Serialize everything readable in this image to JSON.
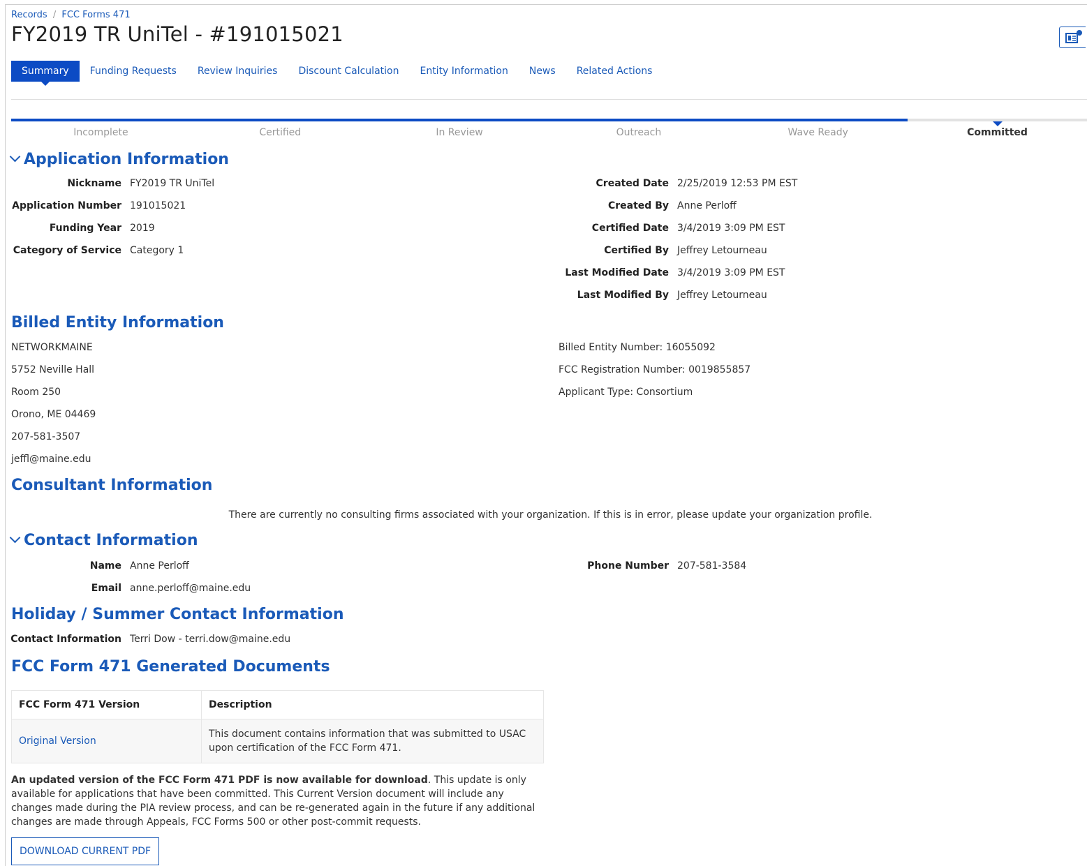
{
  "breadcrumb": {
    "root": "Records",
    "separator": "/",
    "current": "FCC Forms 471"
  },
  "page_title": "FY2019 TR UniTel - #191015021",
  "help_icon": "report-settings-icon",
  "tabs": [
    {
      "label": "Summary",
      "active": true
    },
    {
      "label": "Funding Requests"
    },
    {
      "label": "Review Inquiries"
    },
    {
      "label": "Discount Calculation"
    },
    {
      "label": "Entity Information"
    },
    {
      "label": "News"
    },
    {
      "label": "Related Actions"
    }
  ],
  "status_steps": {
    "items": [
      "Incomplete",
      "Certified",
      "In Review",
      "Outreach",
      "Wave Ready",
      "Committed"
    ],
    "current": "Committed"
  },
  "application_information": {
    "title": "Application Information",
    "left": [
      {
        "label": "Nickname",
        "value": "FY2019 TR UniTel"
      },
      {
        "label": "Application Number",
        "value": "191015021"
      },
      {
        "label": "Funding Year",
        "value": "2019"
      },
      {
        "label": "Category of Service",
        "value": "Category 1"
      }
    ],
    "right": [
      {
        "label": "Created Date",
        "value": "2/25/2019 12:53 PM EST"
      },
      {
        "label": "Created By",
        "value": "Anne Perloff"
      },
      {
        "label": "Certified Date",
        "value": "3/4/2019 3:09 PM EST"
      },
      {
        "label": "Certified By",
        "value": "Jeffrey Letourneau"
      },
      {
        "label": "Last Modified Date",
        "value": "3/4/2019 3:09 PM EST"
      },
      {
        "label": "Last Modified By",
        "value": "Jeffrey Letourneau"
      }
    ]
  },
  "billed_entity": {
    "title": "Billed Entity Information",
    "address_lines": [
      "NETWORKMAINE",
      "5752 Neville Hall",
      "Room 250",
      "Orono, ME 04469",
      "207-581-3507",
      "jeffl@maine.edu"
    ],
    "details": [
      "Billed Entity Number: 16055092",
      "FCC Registration Number: 0019855857",
      "Applicant Type: Consortium"
    ]
  },
  "consultant": {
    "title": "Consultant Information",
    "message": "There are currently no consulting firms associated with your organization. If this is in error, please update your organization profile."
  },
  "contact": {
    "title": "Contact Information",
    "name_label": "Name",
    "name": "Anne Perloff",
    "email_label": "Email",
    "email": "anne.perloff@maine.edu",
    "phone_label": "Phone Number",
    "phone": "207-581-3584"
  },
  "holiday_contact": {
    "title": "Holiday / Summer Contact Information",
    "label": "Contact Information",
    "value": "Terri Dow - terri.dow@maine.edu"
  },
  "generated_documents": {
    "title": "FCC Form 471 Generated Documents",
    "columns": [
      "FCC Form 471 Version",
      "Description"
    ],
    "rows": [
      {
        "version": "Original Version",
        "description": "This document contains information that was submitted to USAC upon certification of the FCC Form 471."
      }
    ]
  },
  "update_note": {
    "bold": "An updated version of the FCC Form 471 PDF is now available for download",
    "rest": ". This update is only available for applications that have been committed. This Current Version document will include any changes made during the PIA review process, and can be re-generated again in the future if any additional changes are made through Appeals, FCC Forms 500 or other post-commit requests."
  },
  "download_button": "DOWNLOAD CURRENT PDF",
  "colors": {
    "accent": "#0c4bc4",
    "link": "#1a5ab8"
  }
}
